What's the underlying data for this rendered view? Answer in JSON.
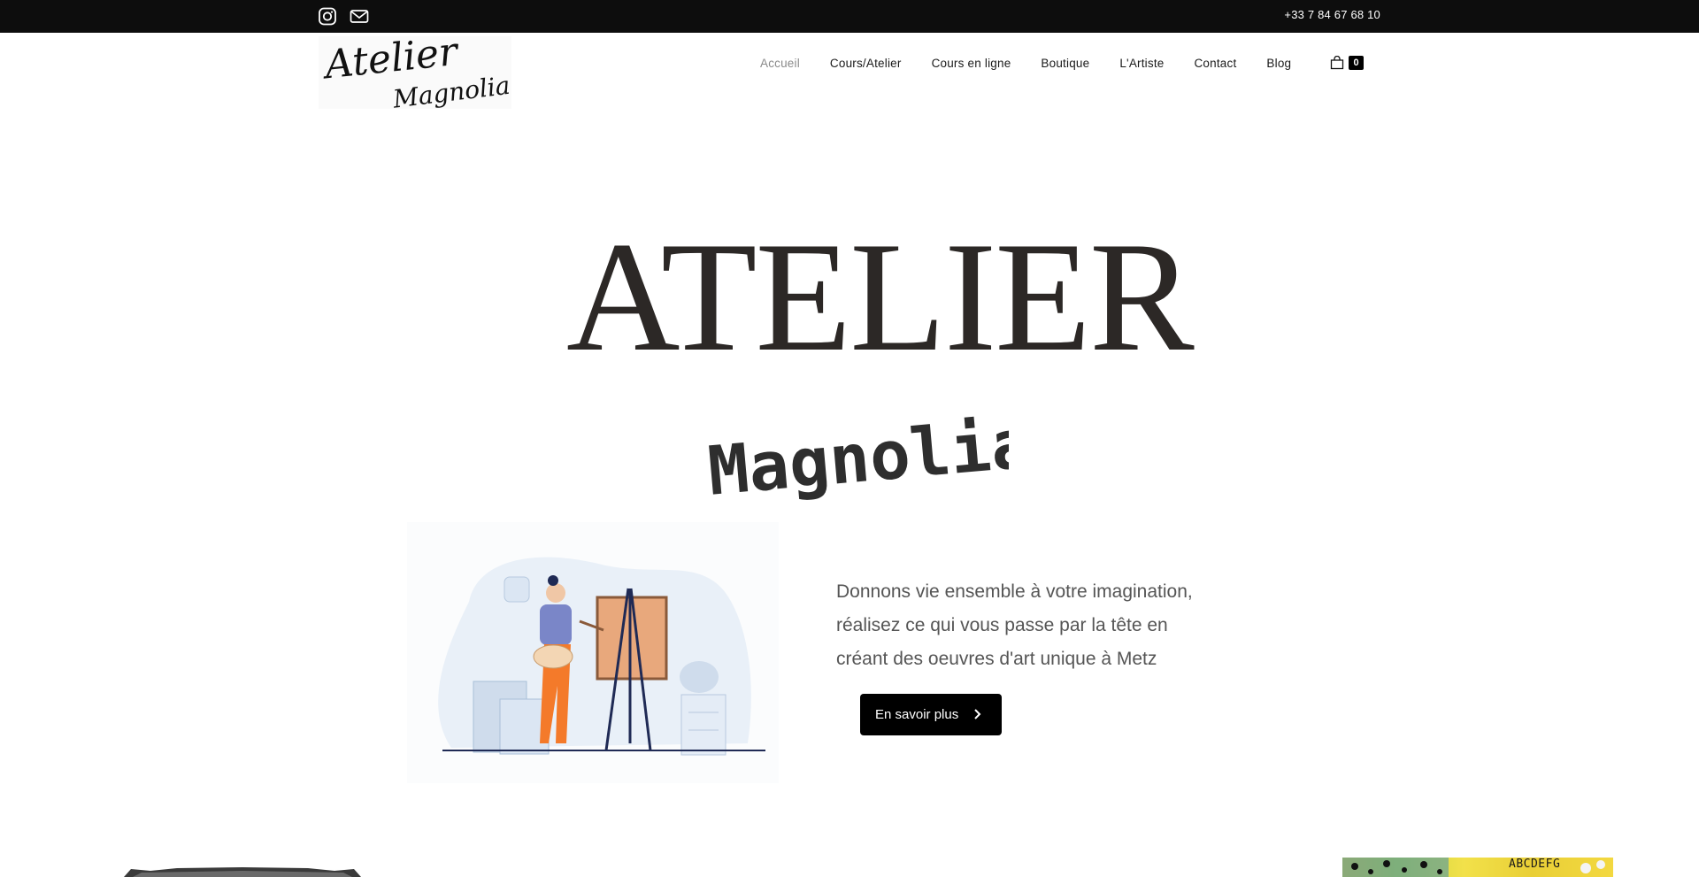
{
  "topbar": {
    "phone": "+33 7 84 67 68 10",
    "icons": [
      "instagram-icon",
      "mail-icon"
    ]
  },
  "brand": {
    "logo_line1": "Atelier",
    "logo_line2": "Magnolia"
  },
  "nav": {
    "items": [
      {
        "label": "Accueil",
        "active": true
      },
      {
        "label": "Cours/Atelier",
        "active": false
      },
      {
        "label": "Cours en ligne",
        "active": false
      },
      {
        "label": "Boutique",
        "active": false
      },
      {
        "label": "L'Artiste",
        "active": false
      },
      {
        "label": "Contact",
        "active": false
      },
      {
        "label": "Blog",
        "active": false
      }
    ],
    "cart_count": "0"
  },
  "hero": {
    "title": "ATELIER",
    "subtitle": "Magnolia"
  },
  "intro": {
    "tagline": "Donnons vie ensemble à votre imagination, réalisez ce qui vous passe par la tête en créant des oeuvres d'art unique à Metz",
    "cta_label": "En savoir plus"
  },
  "bottom_art": {
    "letters": "ABCDEFG"
  },
  "colors": {
    "topbar": "#0d0d0d",
    "title": "#2c2826",
    "nav_active": "#8a8a8a",
    "button": "#000000"
  }
}
